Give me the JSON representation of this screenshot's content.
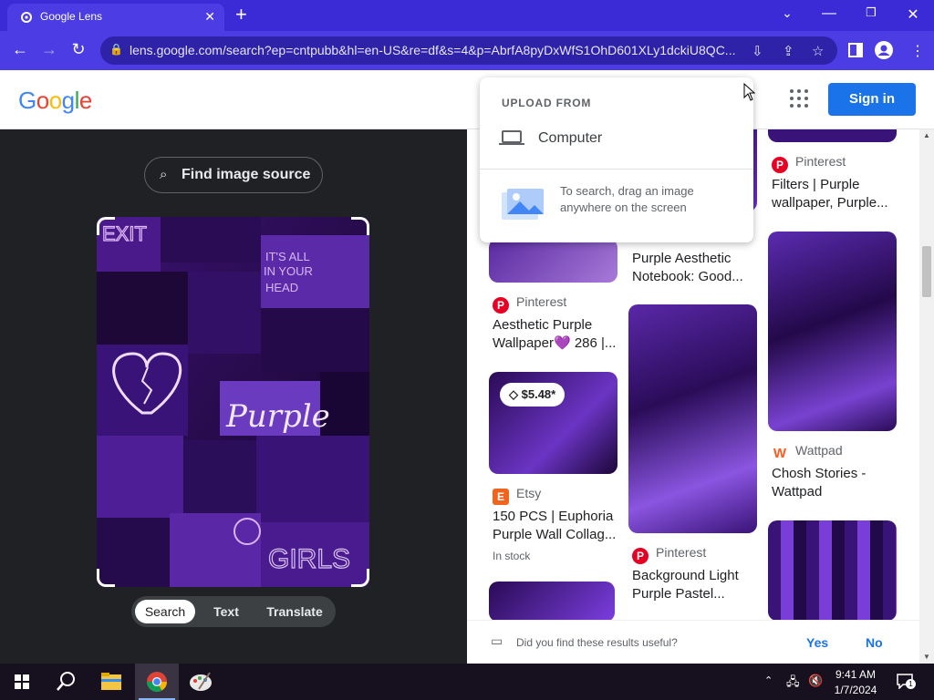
{
  "browser": {
    "tab_title": "Google Lens",
    "url": "lens.google.com/search?ep=cntpubb&hl=en-US&re=df&s=4&p=AbrfA8pyDxWfS1OhD601XLy1dckiU8QC...",
    "colors": {
      "titlebar": "#3a2bd6",
      "toolbar": "#4b3ce3"
    }
  },
  "header": {
    "logo": [
      "G",
      "o",
      "o",
      "g",
      "l",
      "e"
    ],
    "logo_colors": [
      "#4285f4",
      "#ea4335",
      "#fbbc05",
      "#4285f4",
      "#34a853",
      "#ea4335"
    ],
    "sign_in": "Sign in"
  },
  "lens": {
    "find_source": "Find image source",
    "modes": [
      "Search",
      "Text",
      "Translate"
    ],
    "active_mode": "Search",
    "image_text": {
      "exit": "EXIT",
      "its_all": "IT'S ALL IN YOUR HEAD",
      "purple": "Purple",
      "girls": "GIRLS"
    }
  },
  "upload": {
    "header": "UPLOAD FROM",
    "computer": "Computer",
    "drag_text": "To search, drag an image anywhere on the screen"
  },
  "results": {
    "col1": [
      {
        "source": "Pinterest",
        "title": "Aesthetic Purple Wallpaper💜 286 |..."
      },
      {
        "price": "$5.48*",
        "source": "Etsy",
        "title": "150 PCS | Euphoria Purple Wall Collag...",
        "stock": "In stock"
      }
    ],
    "col2": [
      {
        "title": "Purple Aesthetic Notebook: Good..."
      },
      {
        "source": "Pinterest",
        "title": "Background Light Purple Pastel..."
      }
    ],
    "col3": [
      {
        "source": "Pinterest",
        "title": "Filters | Purple wallpaper, Purple..."
      },
      {
        "source": "Wattpad",
        "title": "Chosh Stories - Wattpad"
      }
    ]
  },
  "feedback": {
    "question": "Did you find these results useful?",
    "yes": "Yes",
    "no": "No"
  },
  "taskbar": {
    "time": "9:41 AM",
    "date": "1/7/2024",
    "notif_count": "1"
  }
}
